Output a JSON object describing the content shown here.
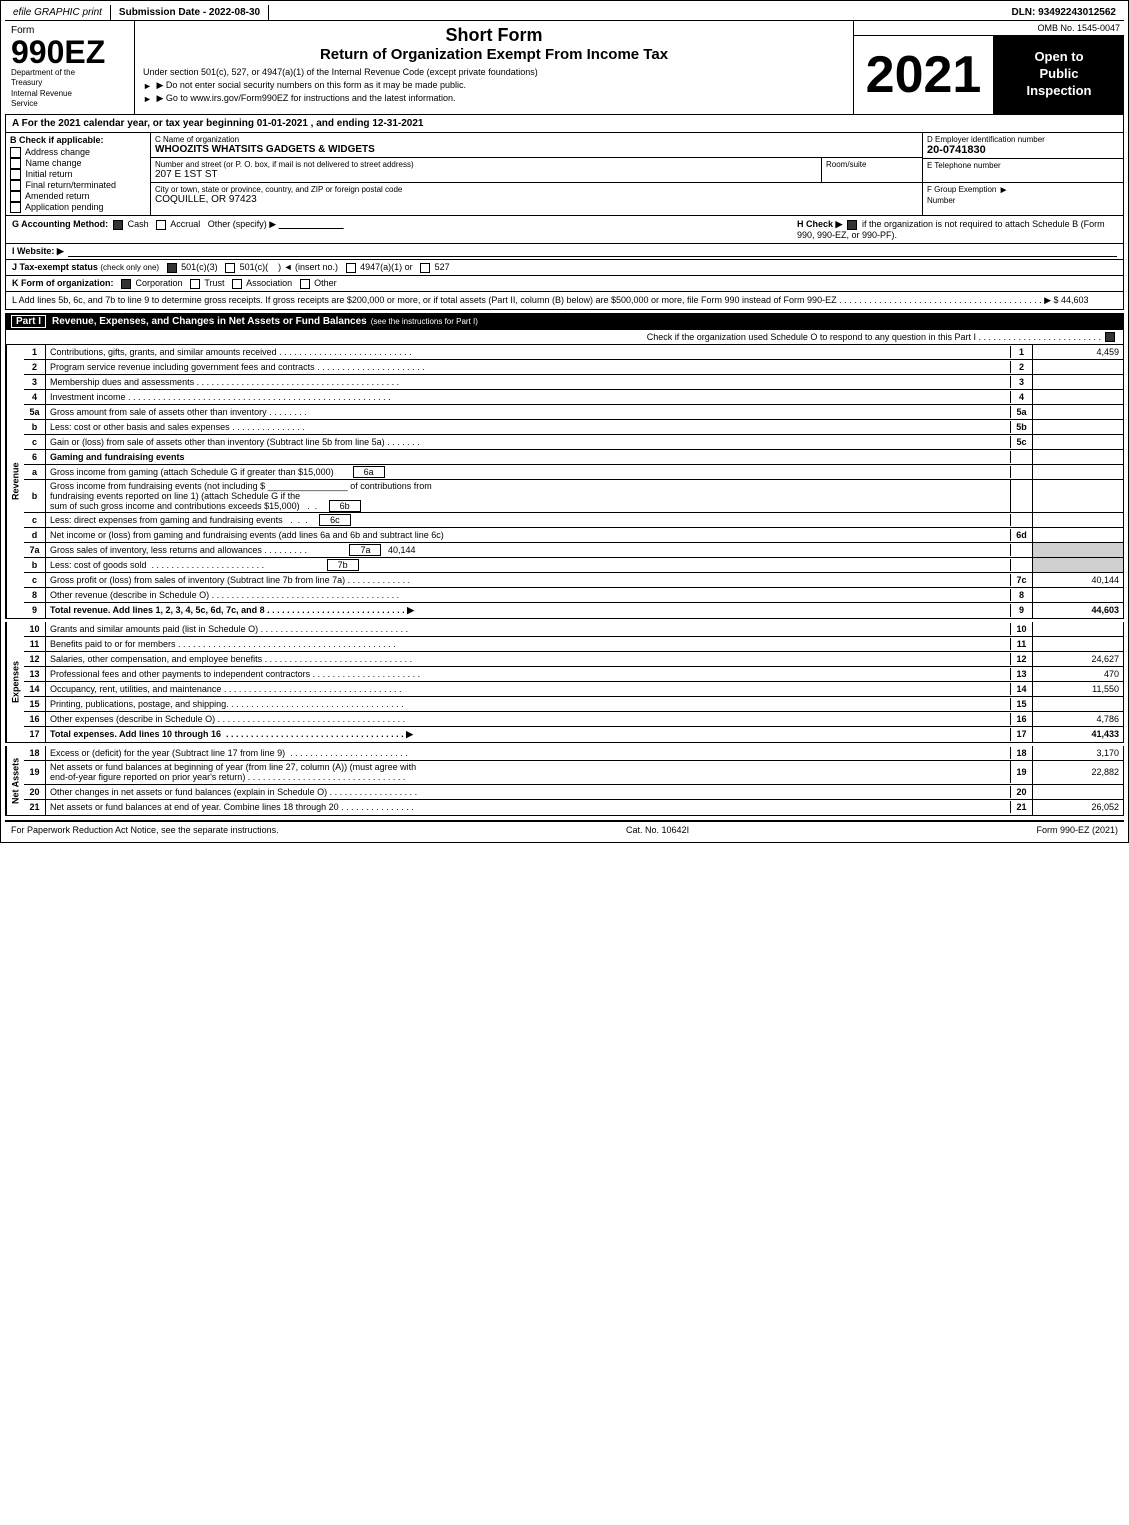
{
  "topbar": {
    "efile": "efile GRAPHIC print",
    "submission": "Submission Date - 2022-08-30",
    "dln": "DLN: 93492243012562"
  },
  "header": {
    "omb": "OMB No. 1545-0047",
    "form_label": "Form",
    "form_number": "990EZ",
    "dept1": "Department of the",
    "dept2": "Treasury",
    "dept3": "Internal Revenue",
    "dept4": "Service",
    "title1": "Short Form",
    "title2": "Return of Organization Exempt From Income Tax",
    "instruction1": "Under section 501(c), 527, or 4947(a)(1) of the Internal Revenue Code (except private foundations)",
    "instruction2": "▶ Do not enter social security numbers on this form as it may be made public.",
    "instruction3": "▶ Go to www.irs.gov/Form990EZ for instructions and the latest information.",
    "year": "2021",
    "open1": "Open to",
    "open2": "Public",
    "open3": "Inspection"
  },
  "section_a": {
    "text": "A  For the 2021 calendar year, or tax year beginning 01-01-2021 , and ending 12-31-2021"
  },
  "section_b": {
    "label": "B  Check if applicable:",
    "options": [
      {
        "id": "address-change",
        "label": "Address change",
        "checked": false
      },
      {
        "id": "name-change",
        "label": "Name change",
        "checked": false
      },
      {
        "id": "initial-return",
        "label": "Initial return",
        "checked": false
      },
      {
        "id": "final-return",
        "label": "Final return/terminated",
        "checked": false
      },
      {
        "id": "amended-return",
        "label": "Amended return",
        "checked": false
      },
      {
        "id": "application-pending",
        "label": "Application pending",
        "checked": false
      }
    ]
  },
  "org": {
    "c_label": "C Name of organization",
    "c_value": "WHOOZITS WHATSITS GADGETS & WIDGETS",
    "address_label": "Number and street (or P. O. box, if mail is not delivered to street address)",
    "address_value": "207 E 1ST ST",
    "room_label": "Room/suite",
    "room_value": "",
    "city_label": "City or town, state or province, country, and ZIP or foreign postal code",
    "city_value": "COQUILLE, OR  97423",
    "d_label": "D Employer identification number",
    "ein": "20-0741830",
    "e_label": "E Telephone number",
    "phone": "",
    "f_label": "F Group Exemption",
    "f_label2": "Number",
    "f_value": ""
  },
  "accounting": {
    "g_label": "G Accounting Method:",
    "cash": "☑ Cash",
    "accrual": "○ Accrual",
    "other": "Other (specify) ▶",
    "other_line": "___________________________",
    "h_label": "H  Check ▶",
    "h_check": "☑",
    "h_text": "if the organization is not required to attach Schedule B (Form 990, 990-EZ, or 990-PF)."
  },
  "website": {
    "i_label": "I Website: ▶"
  },
  "tax_status": {
    "j_label": "J Tax-exempt status",
    "j_note": "(check only one)",
    "options": [
      "☑ 501(c)(3)",
      "○ 501(c)(",
      "  ) ◄ (insert no.)",
      "○ 4947(a)(1) or",
      "○ 527"
    ]
  },
  "form_org": {
    "k_label": "K Form of organization:",
    "options": [
      "☑ Corporation",
      "○ Trust",
      "○ Association",
      "○ Other"
    ]
  },
  "line_l": {
    "text": "L Add lines 5b, 6c, and 7b to line 9 to determine gross receipts. If gross receipts are $200,000 or more, or if total assets (Part II, column (B) below) are $500,000 or more, file Form 990 instead of Form 990-EZ . . . . . . . . . . . . . . . . . . . . . . . . . . . . . . . . . . . . . . . . . ▶ $ 44,603"
  },
  "part1": {
    "label": "Part I",
    "title": "Revenue, Expenses, and Changes in Net Assets or Fund Balances",
    "note": "(see the instructions for Part I)",
    "check_note": "Check if the organization used Schedule O to respond to any question in this Part I . . . . . . . . . . . . . . . . . . . . . . . . .",
    "check": "☑",
    "lines": [
      {
        "num": "1",
        "desc": "Contributions, gifts, grants, and similar amounts received . . . . . . . . . . . . . . . . . . . . . . . . . . .",
        "line_ref": "1",
        "value": "4,459",
        "bold": false
      },
      {
        "num": "2",
        "desc": "Program service revenue including government fees and contracts . . . . . . . . . . . . . . . . . . . . . .",
        "line_ref": "2",
        "value": "",
        "bold": false
      },
      {
        "num": "3",
        "desc": "Membership dues and assessments . . . . . . . . . . . . . . . . . . . . . . . . . . . . . . . . . . . . . . . . .",
        "line_ref": "3",
        "value": "",
        "bold": false
      },
      {
        "num": "4",
        "desc": "Investment income . . . . . . . . . . . . . . . . . . . . . . . . . . . . . . . . . . . . . . . . . . . . . . . . . . . . .",
        "line_ref": "4",
        "value": "",
        "bold": false
      },
      {
        "num": "5a",
        "desc": "Gross amount from sale of assets other than inventory . . . . . . . .",
        "line_ref": "5a",
        "value": "",
        "bold": false,
        "sub": true
      },
      {
        "num": "b",
        "desc": "Less: cost or other basis and sales expenses . . . . . . . . . . . . . . .",
        "line_ref": "5b",
        "value": "",
        "bold": false,
        "sub": true
      },
      {
        "num": "c",
        "desc": "Gain or (loss) from sale of assets other than inventory (Subtract line 5b from line 5a) . . . . . . .",
        "line_ref": "5c",
        "value": "",
        "bold": false
      },
      {
        "num": "6",
        "desc": "Gaming and fundraising events",
        "line_ref": "",
        "value": "",
        "bold": false
      },
      {
        "num": "a",
        "desc": "Gross income from gaming (attach Schedule G if greater than $15,000)",
        "line_ref": "6a",
        "value": "",
        "bold": false,
        "sub": true
      },
      {
        "num": "b",
        "desc": "Gross income from fundraising events (not including $ ________________ of contributions from fundraising events reported on line 1) (attach Schedule G if the sum of such gross income and contributions exceeds $15,000)  .  .",
        "line_ref": "6b",
        "value": "",
        "bold": false,
        "sub": true
      },
      {
        "num": "c",
        "desc": "Less: direct expenses from gaming and fundraising events  .  .  .  .",
        "line_ref": "6c",
        "value": "",
        "bold": false,
        "sub": true
      },
      {
        "num": "d",
        "desc": "Net income or (loss) from gaming and fundraising events (add lines 6a and 6b and subtract line 6c)",
        "line_ref": "6d",
        "value": "",
        "bold": false
      },
      {
        "num": "7a",
        "desc": "Gross sales of inventory, less returns and allowances . . . . . . . . .",
        "line_ref": "7a",
        "value": "40,144",
        "bold": false,
        "sub": true
      },
      {
        "num": "b",
        "desc": "Less: cost of goods sold  .  .  .  .  .  .  .  .  .  .  .  .  .  .  .  .  .  .  .  .  .  .  .",
        "line_ref": "7b",
        "value": "",
        "bold": false,
        "sub": true
      },
      {
        "num": "c",
        "desc": "Gross profit or (loss) from sales of inventory (Subtract line 7b from line 7a) . . . . . . . . . . . . .",
        "line_ref": "7c",
        "value": "40,144",
        "bold": false
      },
      {
        "num": "8",
        "desc": "Other revenue (describe in Schedule O) . . . . . . . . . . . . . . . . . . . . . . . . . . . . . . . . . . . . . .",
        "line_ref": "8",
        "value": "",
        "bold": false
      },
      {
        "num": "9",
        "desc": "Total revenue. Add lines 1, 2, 3, 4, 5c, 6d, 7c, and 8 . . . . . . . . . . . . . . . . . . . . . . . . . . . . ▶",
        "line_ref": "9",
        "value": "44,603",
        "bold": true
      }
    ]
  },
  "part1_expenses": {
    "lines": [
      {
        "num": "10",
        "desc": "Grants and similar amounts paid (list in Schedule O) . . . . . . . . . . . . . . . . . . . . . . . . . . . . . .",
        "line_ref": "10",
        "value": "",
        "bold": false
      },
      {
        "num": "11",
        "desc": "Benefits paid to or for members . . . . . . . . . . . . . . . . . . . . . . . . . . . . . . . . . . . . . . . . . . . .",
        "line_ref": "11",
        "value": "",
        "bold": false
      },
      {
        "num": "12",
        "desc": "Salaries, other compensation, and employee benefits . . . . . . . . . . . . . . . . . . . . . . . . . . . . . .",
        "line_ref": "12",
        "value": "24,627",
        "bold": false
      },
      {
        "num": "13",
        "desc": "Professional fees and other payments to independent contractors . . . . . . . . . . . . . . . . . . . . . .",
        "line_ref": "13",
        "value": "470",
        "bold": false
      },
      {
        "num": "14",
        "desc": "Occupancy, rent, utilities, and maintenance . . . . . . . . . . . . . . . . . . . . . . . . . . . . . . . . . . . .",
        "line_ref": "14",
        "value": "11,550",
        "bold": false
      },
      {
        "num": "15",
        "desc": "Printing, publications, postage, and shipping. . . . . . . . . . . . . . . . . . . . . . . . . . . . . . . . . . . .",
        "line_ref": "15",
        "value": "",
        "bold": false
      },
      {
        "num": "16",
        "desc": "Other expenses (describe in Schedule O) . . . . . . . . . . . . . . . . . . . . . . . . . . . . . . . . . . . . . .",
        "line_ref": "16",
        "value": "4,786",
        "bold": false
      },
      {
        "num": "17",
        "desc": "Total expenses. Add lines 10 through 16  . . . . . . . . . . . . . . . . . . . . . . . . . . . . . . . . . . . . ▶",
        "line_ref": "17",
        "value": "41,433",
        "bold": true
      }
    ]
  },
  "part1_assets": {
    "lines": [
      {
        "num": "18",
        "desc": "Excess or (deficit) for the year (Subtract line 17 from line 9)  . . . . . . . . . . . . . . . . . . . . . . . .",
        "line_ref": "18",
        "value": "3,170",
        "bold": false
      },
      {
        "num": "19",
        "desc": "Net assets or fund balances at beginning of year (from line 27, column (A)) (must agree with end-of-year figure reported on prior year's return) . . . . . . . . . . . . . . . . . . . . . . . . . . . . . . . .",
        "line_ref": "19",
        "value": "22,882",
        "bold": false
      },
      {
        "num": "20",
        "desc": "Other changes in net assets or fund balances (explain in Schedule O) . . . . . . . . . . . . . . . . . .",
        "line_ref": "20",
        "value": "",
        "bold": false
      },
      {
        "num": "21",
        "desc": "Net assets or fund balances at end of year. Combine lines 18 through 20 . . . . . . . . . . . . . . .",
        "line_ref": "21",
        "value": "26,052",
        "bold": false
      }
    ]
  },
  "footer": {
    "left": "For Paperwork Reduction Act Notice, see the separate instructions.",
    "cat": "Cat. No. 10642I",
    "right": "Form 990-EZ (2021)"
  }
}
